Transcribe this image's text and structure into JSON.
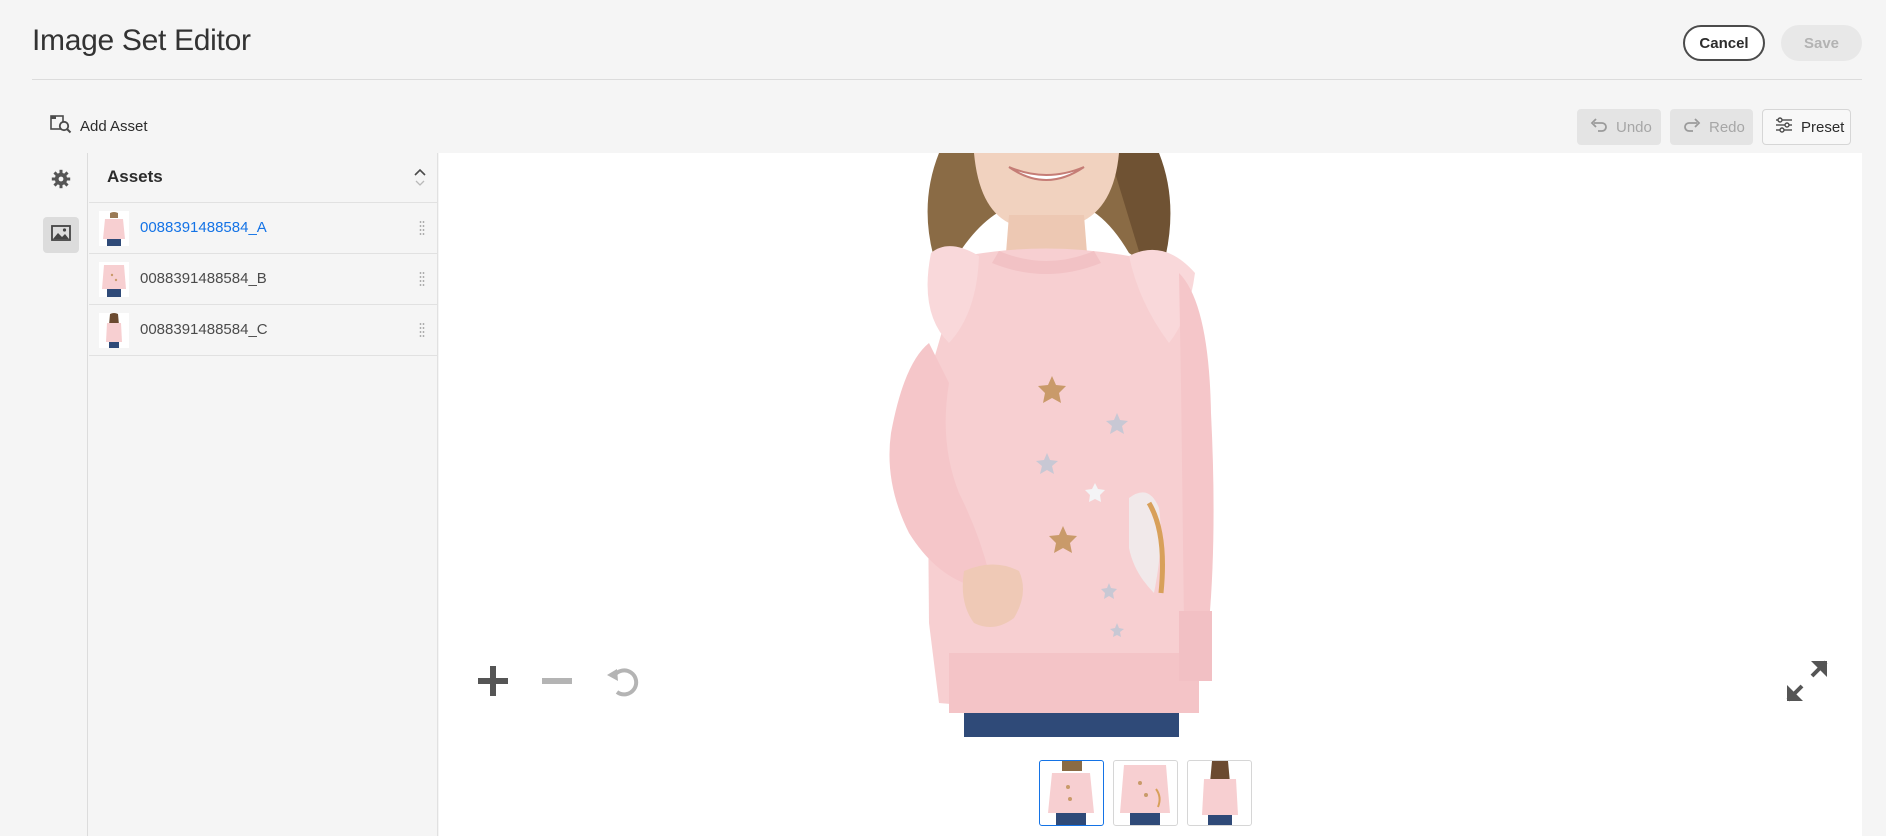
{
  "header": {
    "title": "Image Set Editor",
    "cancel_label": "Cancel",
    "save_label": "Save"
  },
  "toolbar": {
    "add_asset_label": "Add Asset",
    "undo_label": "Undo",
    "redo_label": "Redo",
    "preset_label": "Preset"
  },
  "rail": {
    "items": [
      {
        "icon": "gear-icon"
      },
      {
        "icon": "image-icon",
        "active": true
      }
    ]
  },
  "assets": {
    "title": "Assets",
    "items": [
      {
        "name": "0088391488584_A",
        "selected": true
      },
      {
        "name": "0088391488584_B",
        "selected": false
      },
      {
        "name": "0088391488584_C",
        "selected": false
      }
    ]
  },
  "colors": {
    "accent": "#1473e6",
    "sweater": "#f7cfd1",
    "jeans": "#2f4a78"
  },
  "thumbnails": [
    {
      "asset": "0088391488584_A",
      "active": true
    },
    {
      "asset": "0088391488584_B",
      "active": false
    },
    {
      "asset": "0088391488584_C",
      "active": false
    }
  ]
}
